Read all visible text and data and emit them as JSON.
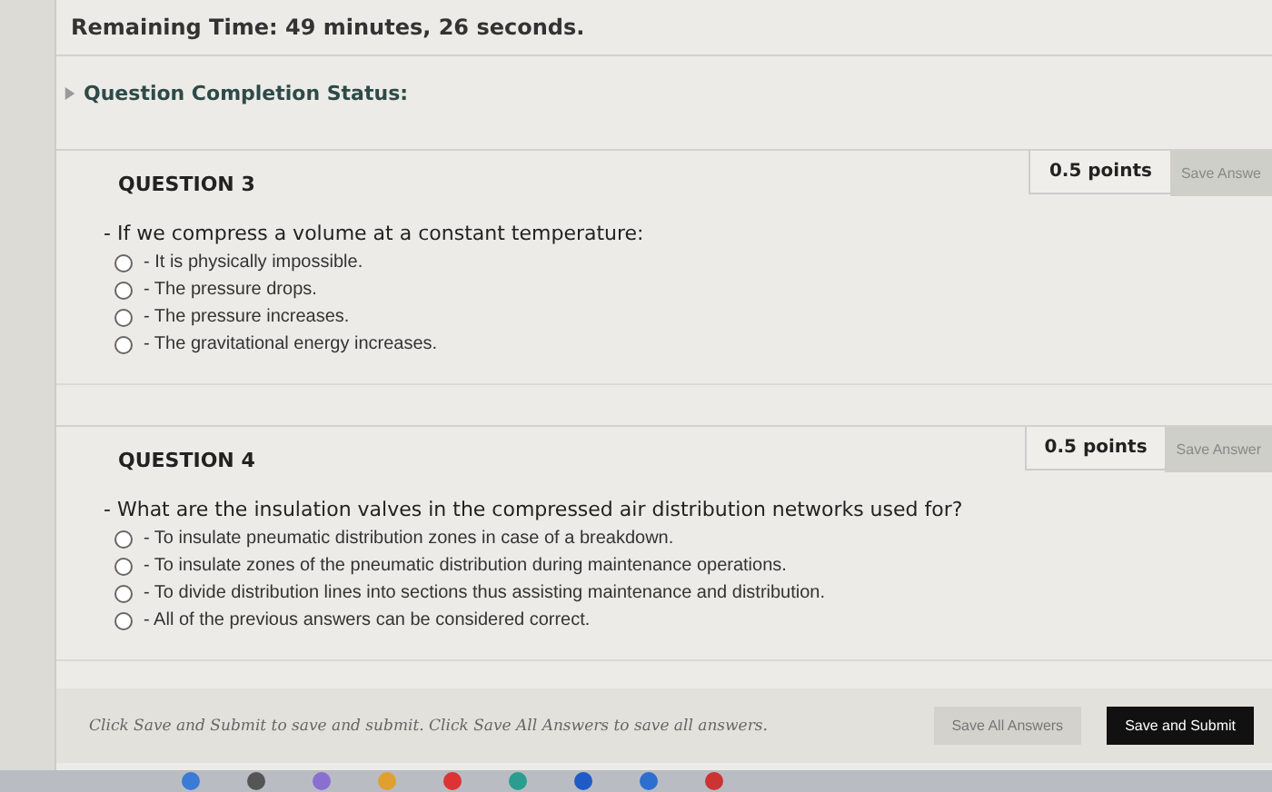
{
  "timer": {
    "label": "Remaining Time:",
    "value": "49 minutes, 26 seconds."
  },
  "completion_status": {
    "label": "Question Completion Status:",
    "expanded": false
  },
  "questions": [
    {
      "title": "QUESTION 3",
      "points": "0.5 points",
      "save_button": "Save Answe",
      "prompt": "- If we compress a volume at a constant temperature:",
      "options": [
        {
          "label": "- It is physically impossible.",
          "selected": false
        },
        {
          "label": "- The pressure drops.",
          "selected": false
        },
        {
          "label": "- The pressure increases.",
          "selected": false
        },
        {
          "label": "- The gravitational energy increases.",
          "selected": false
        }
      ]
    },
    {
      "title": "QUESTION 4",
      "points": "0.5 points",
      "save_button": "Save Answer",
      "prompt": "- What are the insulation valves in the compressed air distribution networks used for?",
      "options": [
        {
          "label": "- To insulate pneumatic distribution zones in case of a breakdown.",
          "selected": false
        },
        {
          "label": "- To insulate zones of the pneumatic distribution during maintenance operations.",
          "selected": false
        },
        {
          "label": "- To divide distribution lines into sections thus assisting maintenance and distribution.",
          "selected": false
        },
        {
          "label": "- All of the previous answers can be considered correct.",
          "selected": false
        }
      ]
    }
  ],
  "footer": {
    "instructions": "Click Save and Submit to save and submit. Click Save All Answers to save all answers.",
    "buttons": [
      {
        "label": "Save All Answers",
        "kind": "secondary"
      },
      {
        "label": "Save and Submit",
        "kind": "primary"
      }
    ]
  }
}
